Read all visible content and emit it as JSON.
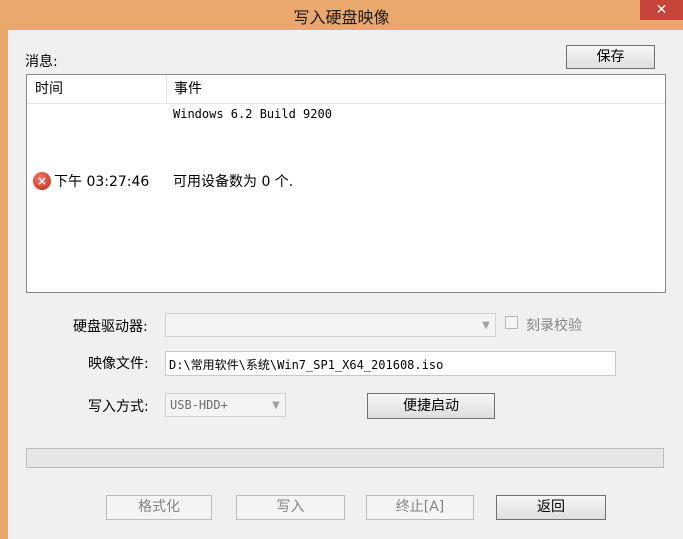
{
  "window": {
    "title": "写入硬盘映像",
    "close_glyph": "✕"
  },
  "messages": {
    "label": "消息:",
    "save_button": "保存",
    "columns": {
      "time": "时间",
      "event": "事件"
    },
    "rows": [
      {
        "time": "",
        "event": "Windows 6.2 Build 9200"
      },
      {
        "time": "下午 03:27:46",
        "event": "可用设备数为 0 个.",
        "icon": "error-icon"
      }
    ]
  },
  "form": {
    "drive_label": "硬盘驱动器:",
    "drive_value": "",
    "verify_label": "刻录校验",
    "image_label": "映像文件:",
    "image_path": "D:\\常用软件\\系统\\Win7_SP1_X64_201608.iso",
    "write_mode_label": "写入方式:",
    "write_mode_value": "USB-HDD+",
    "quick_boot_button": "便捷启动"
  },
  "progress": {
    "value": 0
  },
  "buttons": {
    "format": "格式化",
    "write": "写入",
    "stop": "终止[A]",
    "back": "返回"
  },
  "colors": {
    "error": "#c1271a",
    "titlebar": "#eaa86d",
    "close": "#c7443a"
  }
}
